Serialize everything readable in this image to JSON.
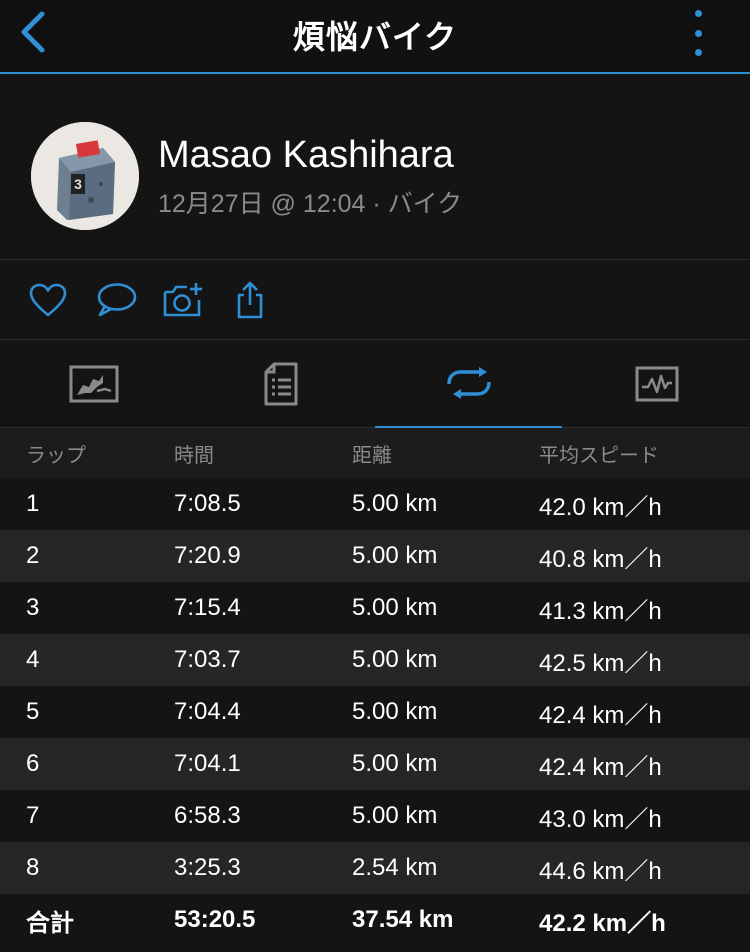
{
  "header": {
    "title": "煩悩バイク"
  },
  "profile": {
    "name": "Masao Kashihara",
    "meta": "12月27日 @ 12:04 · バイク"
  },
  "actions": [
    {
      "icon": "heart-icon"
    },
    {
      "icon": "comment-icon"
    },
    {
      "icon": "add-photo-icon"
    },
    {
      "icon": "share-icon"
    }
  ],
  "tabs": [
    {
      "icon": "map-icon",
      "active": false
    },
    {
      "icon": "details-icon",
      "active": false
    },
    {
      "icon": "laps-icon",
      "active": true
    },
    {
      "icon": "graph-icon",
      "active": false
    }
  ],
  "laps": {
    "headers": [
      "ラップ",
      "時間",
      "距離",
      "平均スピード"
    ],
    "rows": [
      [
        "1",
        "7:08.5",
        "5.00 km",
        "42.0 km／h"
      ],
      [
        "2",
        "7:20.9",
        "5.00 km",
        "40.8 km／h"
      ],
      [
        "3",
        "7:15.4",
        "5.00 km",
        "41.3 km／h"
      ],
      [
        "4",
        "7:03.7",
        "5.00 km",
        "42.5 km／h"
      ],
      [
        "5",
        "7:04.4",
        "5.00 km",
        "42.4 km／h"
      ],
      [
        "6",
        "7:04.1",
        "5.00 km",
        "42.4 km／h"
      ],
      [
        "7",
        "6:58.3",
        "5.00 km",
        "43.0 km／h"
      ],
      [
        "8",
        "3:25.3",
        "2.54 km",
        "44.6 km／h"
      ]
    ],
    "total": [
      "合計",
      "53:20.5",
      "37.54 km",
      "42.2 km／h"
    ]
  },
  "colors": {
    "accent": "#2f8fd4",
    "background": "#141414",
    "row_alt": "#262626",
    "muted_text": "#8a8a8a"
  }
}
